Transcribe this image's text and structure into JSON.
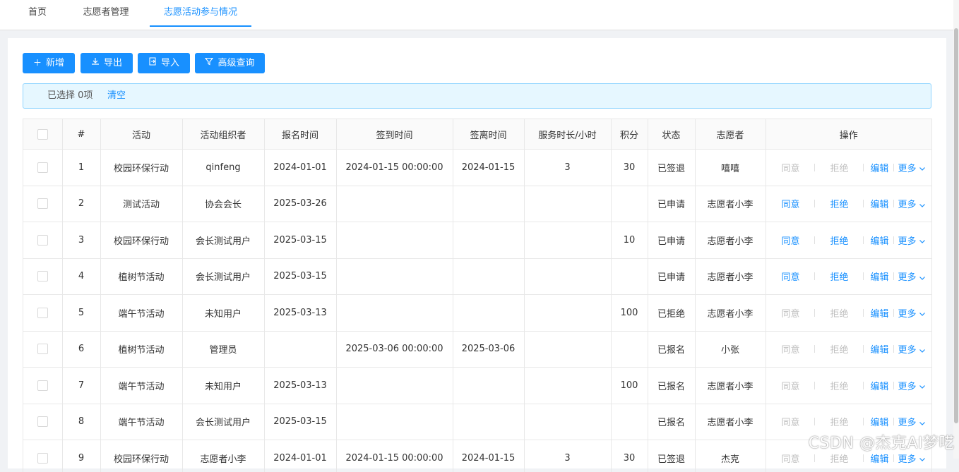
{
  "tabs": [
    {
      "label": "首页",
      "active": false
    },
    {
      "label": "志愿者管理",
      "active": false
    },
    {
      "label": "志愿活动参与情况",
      "active": true
    }
  ],
  "toolbar": {
    "add_label": "新增",
    "export_label": "导出",
    "import_label": "导入",
    "advanced_search_label": "高级查询"
  },
  "selection": {
    "text": "已选择 0项",
    "clear_label": "清空"
  },
  "table": {
    "headers": [
      "",
      "#",
      "活动",
      "活动组织者",
      "报名时间",
      "签到时间",
      "签离时间",
      "服务时长/小时",
      "积分",
      "状态",
      "志愿者",
      "操作"
    ],
    "actions": {
      "agree": "同意",
      "reject": "拒绝",
      "edit": "编辑",
      "more": "更多"
    },
    "rows": [
      {
        "no": "1",
        "activity": "校园环保行动",
        "organizer": "qinfeng",
        "signup": "2024-01-01",
        "checkin": "2024-01-15 00:00:00",
        "checkout": "2024-01-15",
        "hours": "3",
        "points": "30",
        "status": "已签退",
        "volunteer": "嘻嘻",
        "agree_on": false,
        "reject_on": false
      },
      {
        "no": "2",
        "activity": "测试活动",
        "organizer": "协会会长",
        "signup": "2025-03-26",
        "checkin": "",
        "checkout": "",
        "hours": "",
        "points": "",
        "status": "已申请",
        "volunteer": "志愿者小李",
        "agree_on": true,
        "reject_on": true
      },
      {
        "no": "3",
        "activity": "校园环保行动",
        "organizer": "会长测试用户",
        "signup": "2025-03-15",
        "checkin": "",
        "checkout": "",
        "hours": "",
        "points": "10",
        "status": "已申请",
        "volunteer": "志愿者小李",
        "agree_on": true,
        "reject_on": true
      },
      {
        "no": "4",
        "activity": "植树节活动",
        "organizer": "会长测试用户",
        "signup": "2025-03-15",
        "checkin": "",
        "checkout": "",
        "hours": "",
        "points": "",
        "status": "已申请",
        "volunteer": "志愿者小李",
        "agree_on": true,
        "reject_on": true
      },
      {
        "no": "5",
        "activity": "端午节活动",
        "organizer": "未知用户",
        "signup": "2025-03-13",
        "checkin": "",
        "checkout": "",
        "hours": "",
        "points": "100",
        "status": "已拒绝",
        "volunteer": "志愿者小李",
        "agree_on": false,
        "reject_on": false
      },
      {
        "no": "6",
        "activity": "植树节活动",
        "organizer": "管理员",
        "signup": "",
        "checkin": "2025-03-06 00:00:00",
        "checkout": "2025-03-06",
        "hours": "",
        "points": "",
        "status": "已报名",
        "volunteer": "小张",
        "agree_on": false,
        "reject_on": false
      },
      {
        "no": "7",
        "activity": "端午节活动",
        "organizer": "未知用户",
        "signup": "2025-03-13",
        "checkin": "",
        "checkout": "",
        "hours": "",
        "points": "100",
        "status": "已报名",
        "volunteer": "志愿者小李",
        "agree_on": false,
        "reject_on": false
      },
      {
        "no": "8",
        "activity": "端午节活动",
        "organizer": "会长测试用户",
        "signup": "2025-03-15",
        "checkin": "",
        "checkout": "",
        "hours": "",
        "points": "",
        "status": "已报名",
        "volunteer": "志愿者小李",
        "agree_on": false,
        "reject_on": false
      },
      {
        "no": "9",
        "activity": "校园环保行动",
        "organizer": "志愿者小李",
        "signup": "2024-01-01",
        "checkin": "2024-01-15 00:00:00",
        "checkout": "2024-01-15",
        "hours": "3",
        "points": "30",
        "status": "已签退",
        "volunteer": "杰克",
        "agree_on": false,
        "reject_on": false
      }
    ]
  },
  "watermark": "CSDN @杰克AI梦呓",
  "colors": {
    "primary": "#1890ff",
    "disabled": "#bfbfbf",
    "alert_bg": "#e6f7ff"
  }
}
